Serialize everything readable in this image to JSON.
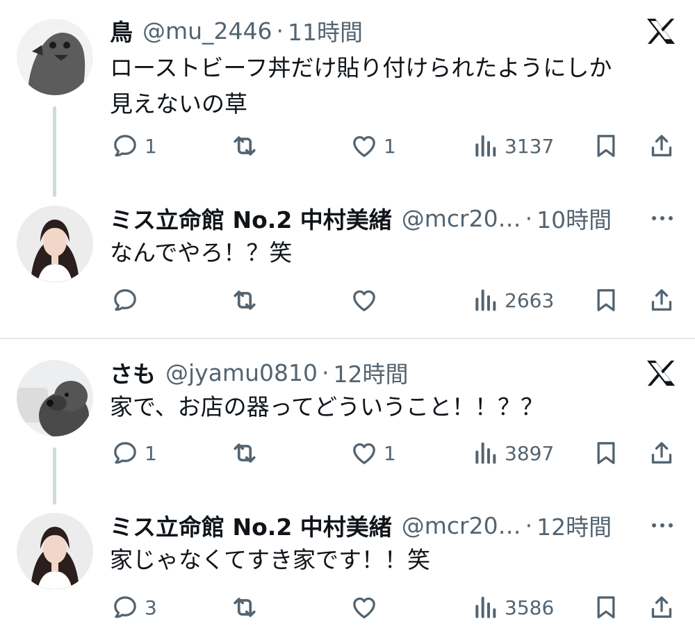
{
  "threads": [
    {
      "tweets": [
        {
          "name": "鳥",
          "handle": "@mu_2446",
          "dot": "·",
          "time": "11時間",
          "text_line1": "ローストビーフ丼だけ貼り付けられたようにしか",
          "text_line2": "見えないの草",
          "reply_count": "1",
          "like_count": "1",
          "views": "3137",
          "avatar_icon": "bird-avatar-icon"
        },
        {
          "name": "ミス立命館 No.2 中村美緒",
          "handle": "@mcr20…",
          "dot": "·",
          "time": "10時間",
          "text_line1": "なんでやろ！？笑",
          "reply_count": "",
          "like_count": "",
          "views": "2663",
          "avatar_icon": "person-avatar-icon"
        }
      ]
    },
    {
      "tweets": [
        {
          "name": "さも",
          "handle": "@jyamu0810",
          "dot": "·",
          "time": "12時間",
          "text_line1": "家で、お店の器ってどういうこと！！？？",
          "reply_count": "1",
          "like_count": "1",
          "views": "3897",
          "avatar_icon": "dog-avatar-icon"
        },
        {
          "name": "ミス立命館 No.2 中村美緒",
          "handle": "@mcr20…",
          "dot": "·",
          "time": "12時間",
          "text_line1": "家じゃなくてすき家です！！笑",
          "reply_count": "3",
          "like_count": "",
          "views": "3586",
          "avatar_icon": "person-avatar-icon"
        }
      ]
    }
  ],
  "colors": {
    "text_primary": "#0f1419",
    "text_secondary": "#536471",
    "connector": "#cfd9de",
    "divider": "#e6e6e6"
  },
  "icons": [
    "reply-icon",
    "retweet-icon",
    "like-icon",
    "views-icon",
    "bookmark-icon",
    "share-icon",
    "x-logo-icon",
    "more-icon"
  ]
}
